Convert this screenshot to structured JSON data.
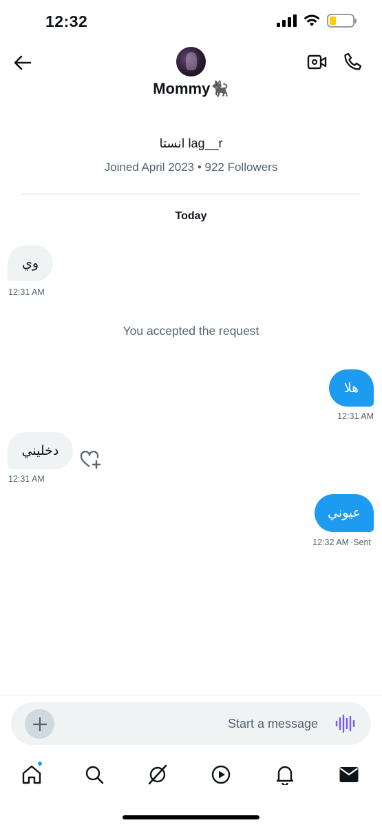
{
  "status_bar": {
    "time": "12:32",
    "battery_color": "#ffcc00",
    "icons": [
      "cellular-signal-icon",
      "wifi-icon",
      "battery-icon"
    ]
  },
  "header": {
    "contact_name": "Mommy🐈‍⬛",
    "icons": [
      "back-arrow-icon",
      "video-camera-icon",
      "phone-icon"
    ]
  },
  "profile": {
    "handle": "انستا lag__r",
    "meta": "Joined April 2023 • 922 Followers"
  },
  "conversation": {
    "date_label": "Today",
    "messages": [
      {
        "direction": "incoming",
        "text": "وي",
        "time": "12:31 AM"
      },
      {
        "direction": "incoming",
        "text": "دخليني",
        "time": "12:31 AM"
      }
    ],
    "system_message": "You accepted the request",
    "outgoing": [
      {
        "direction": "outgoing",
        "text": "هلا",
        "time": "12:31 AM"
      },
      {
        "direction": "outgoing",
        "text": "عيوني",
        "time": "12:32 AM",
        "status": "·Sent"
      }
    ]
  },
  "composer": {
    "placeholder": "Start a message",
    "icons": [
      "plus-icon",
      "voice-waveform-icon"
    ],
    "voice_color": "#7856ff"
  },
  "tab_bar": {
    "tabs": [
      "home",
      "search",
      "grok",
      "video",
      "notifications",
      "messages"
    ],
    "active_dot_color": "#1d9bf0"
  },
  "colors": {
    "outgoing_bubble": "#1d9bf0",
    "incoming_bubble": "#eff3f4",
    "secondary_text": "#536471"
  }
}
